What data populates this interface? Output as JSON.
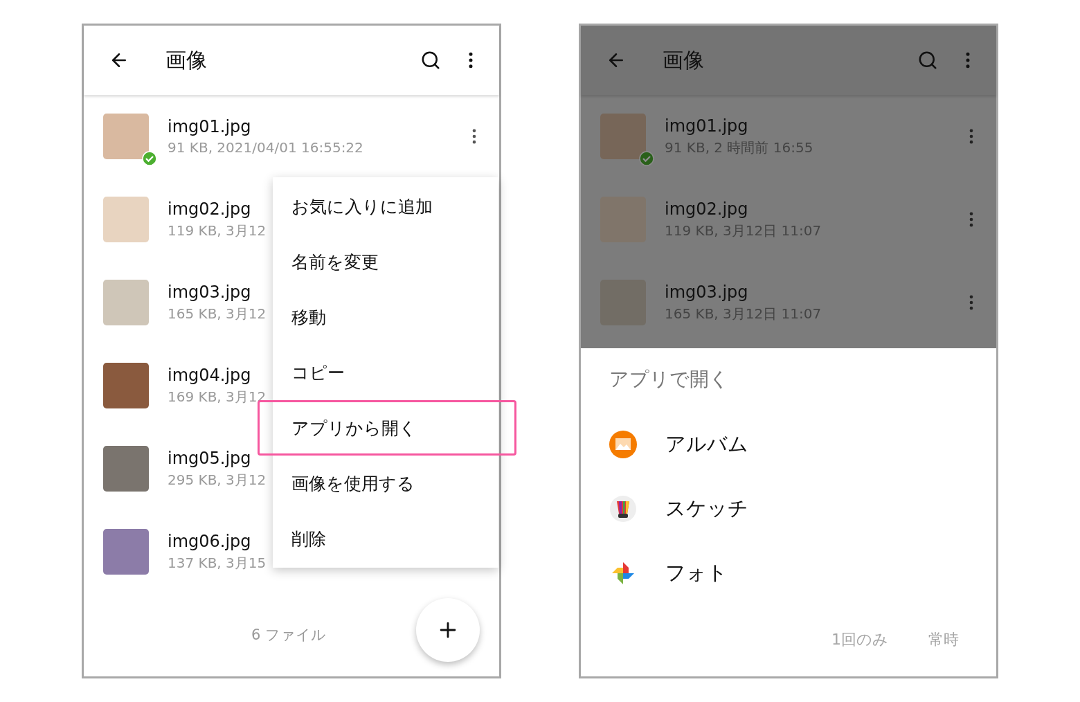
{
  "screens": [
    {
      "dimmed": false,
      "app_bar": {
        "title": "画像"
      },
      "files": [
        {
          "name": "img01.jpg",
          "meta": "91 KB, 2021/04/01 16:55:22",
          "synced": true
        },
        {
          "name": "img02.jpg",
          "meta": "119 KB, 3月12",
          "synced": false
        },
        {
          "name": "img03.jpg",
          "meta": "165 KB, 3月12",
          "synced": false
        },
        {
          "name": "img04.jpg",
          "meta": "169 KB, 3月12",
          "synced": false
        },
        {
          "name": "img05.jpg",
          "meta": "295 KB, 3月12",
          "synced": false
        },
        {
          "name": "img06.jpg",
          "meta": "137 KB, 3月15",
          "synced": false
        }
      ],
      "context_menu": {
        "items": [
          {
            "label": "お気に入りに追加",
            "highlighted": false
          },
          {
            "label": "名前を変更",
            "highlighted": false
          },
          {
            "label": "移動",
            "highlighted": false
          },
          {
            "label": "コピー",
            "highlighted": false
          },
          {
            "label": "アプリから開く",
            "highlighted": true
          },
          {
            "label": "画像を使用する",
            "highlighted": false
          },
          {
            "label": "削除",
            "highlighted": false
          }
        ]
      },
      "footer": "6 ファイル"
    },
    {
      "dimmed": true,
      "app_bar": {
        "title": "画像"
      },
      "files": [
        {
          "name": "img01.jpg",
          "meta": "91 KB, 2 時間前 16:55",
          "synced": true
        },
        {
          "name": "img02.jpg",
          "meta": "119 KB, 3月12日 11:07",
          "synced": false
        },
        {
          "name": "img03.jpg",
          "meta": "165 KB, 3月12日 11:07",
          "synced": false
        }
      ],
      "sheet": {
        "title": "アプリで開く",
        "apps": [
          {
            "name": "アルバム",
            "kind": "album"
          },
          {
            "name": "スケッチ",
            "kind": "sketch"
          },
          {
            "name": "フォト",
            "kind": "photos"
          }
        ],
        "buttons": [
          {
            "label": "1回のみ",
            "disabled": true
          },
          {
            "label": "常時",
            "disabled": true
          }
        ]
      }
    }
  ]
}
